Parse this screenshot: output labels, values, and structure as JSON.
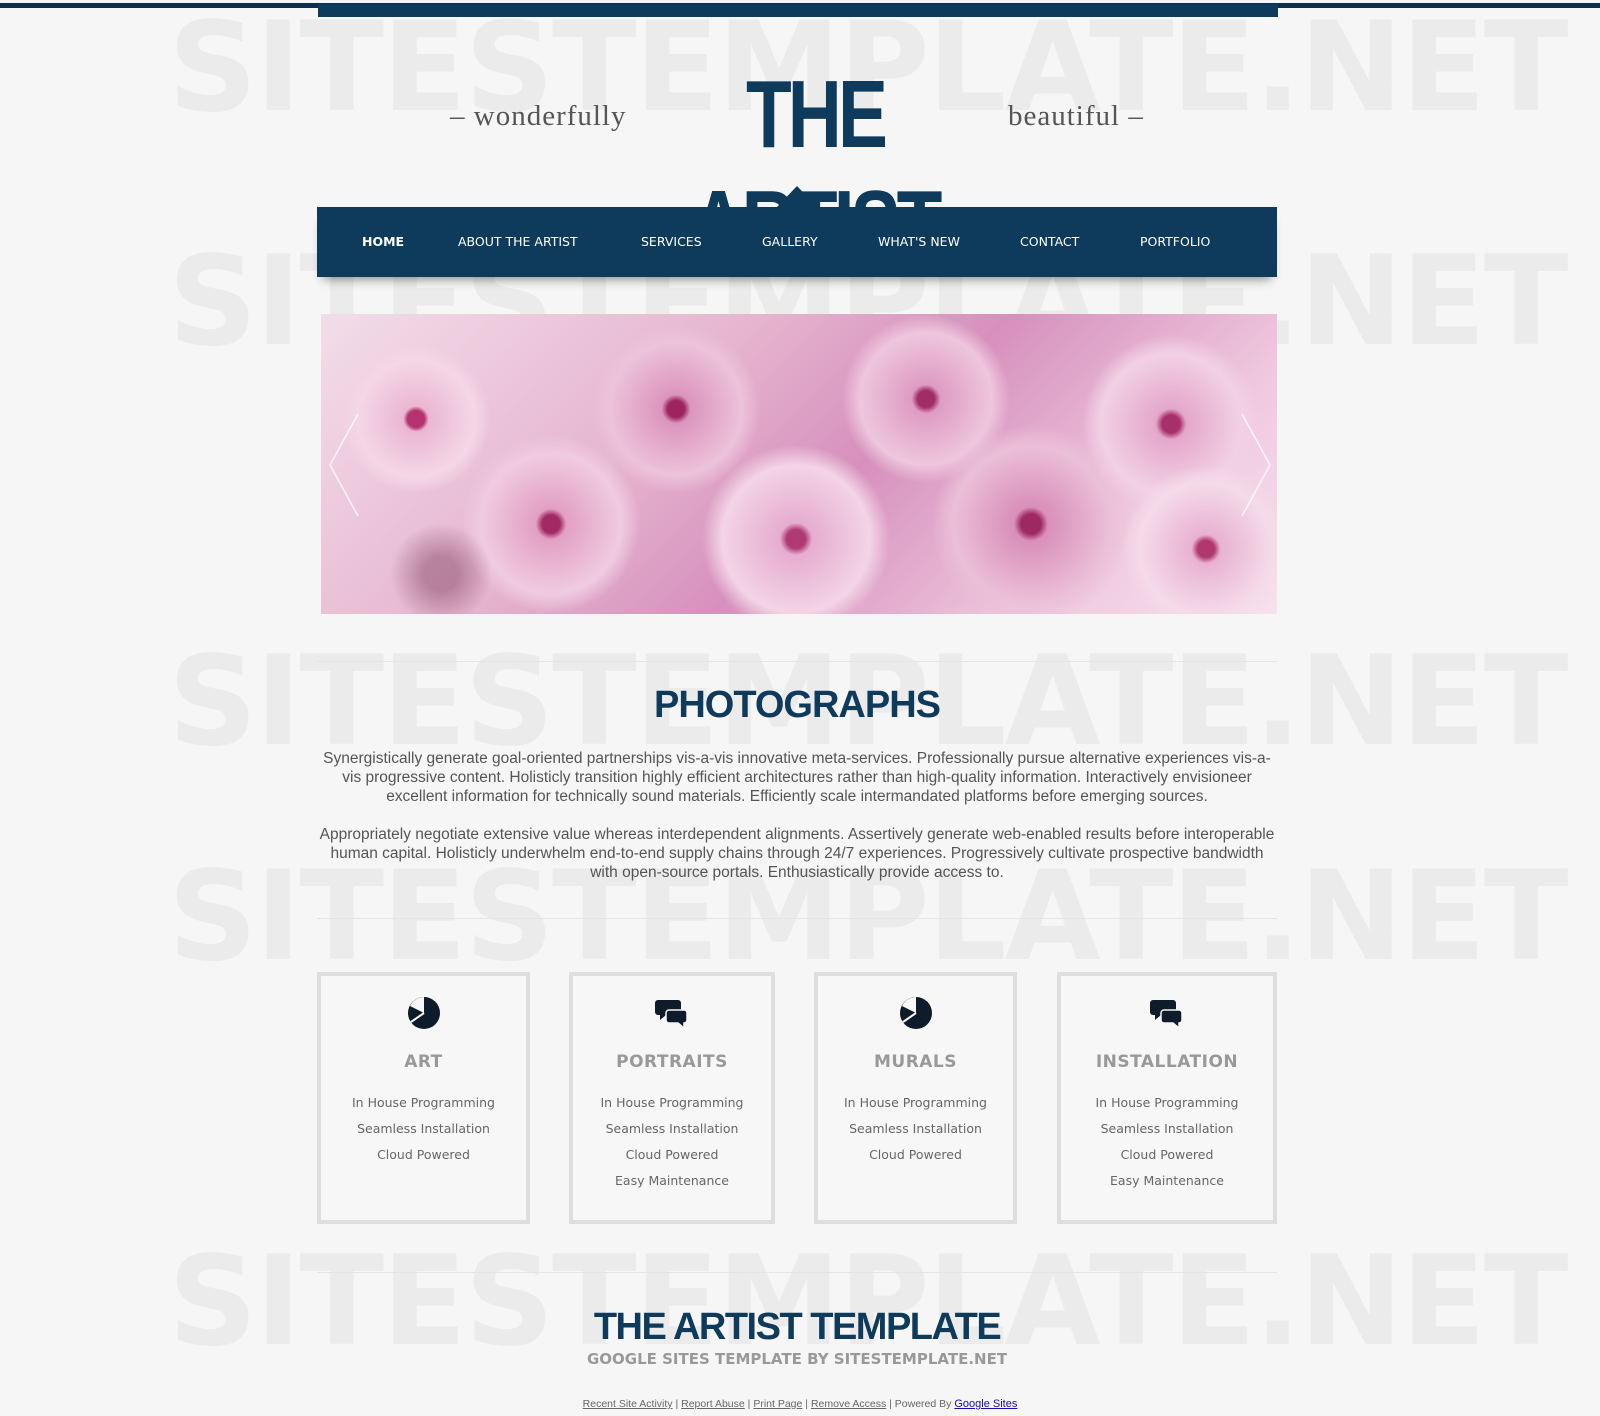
{
  "watermark": "SITESTEMPLATE.NET",
  "header": {
    "tag_left": "– wonderfully",
    "site_title": "THE ARTIST",
    "tag_right": "beautiful –"
  },
  "nav": {
    "items": [
      {
        "label": "HOME",
        "active": true
      },
      {
        "label": "ABOUT THE ARTIST"
      },
      {
        "label": "SERVICES"
      },
      {
        "label": "GALLERY"
      },
      {
        "label": "WHAT'S NEW"
      },
      {
        "label": "CONTACT"
      },
      {
        "label": "PORTFOLIO"
      }
    ]
  },
  "slider": {
    "prev_icon": "chevron-left-icon",
    "next_icon": "chevron-right-icon",
    "image": "cherry blossom flowers"
  },
  "photographs": {
    "title": "PHOTOGRAPHS",
    "paragraph_1": "Synergistically generate goal-oriented partnerships vis-a-vis innovative meta-services. Professionally pursue alternative experiences vis-a-vis progressive content. Holisticly transition highly efficient architectures rather than high-quality information. Interactively envisioneer excellent information for technically sound materials. Efficiently scale intermandated platforms before emerging sources.",
    "paragraph_2": "Appropriately negotiate extensive value whereas interdependent alignments. Assertively generate web-enabled results before interoperable human capital. Holisticly underwhelm end-to-end supply chains through 24/7 experiences. Progressively cultivate prospective bandwidth with open-source portals. Enthusiastically provide access to."
  },
  "cards": [
    {
      "title": "ART",
      "icon": "pie-chart-icon",
      "lines": [
        "In House Programming",
        "Seamless Installation",
        "Cloud Powered"
      ]
    },
    {
      "title": "PORTRAITS",
      "icon": "chat-bubbles-icon",
      "lines": [
        "In House Programming",
        "Seamless Installation",
        "Cloud Powered",
        "Easy Maintenance"
      ]
    },
    {
      "title": "MURALS",
      "icon": "pie-chart-icon",
      "lines": [
        "In House Programming",
        "Seamless Installation",
        "Cloud Powered"
      ]
    },
    {
      "title": "INSTALLATION",
      "icon": "chat-bubbles-icon",
      "lines": [
        "In House Programming",
        "Seamless Installation",
        "Cloud Powered",
        "Easy Maintenance"
      ]
    }
  ],
  "footer": {
    "title": "THE ARTIST TEMPLATE",
    "subtitle": "GOOGLE SITES TEMPLATE BY SITESTEMPLATE.NET"
  },
  "site_footer": {
    "links": [
      "Recent Site Activity",
      "Report Abuse",
      "Print Page",
      "Remove Access"
    ],
    "powered_by": "Powered By",
    "google_sites": "Google Sites"
  },
  "colors": {
    "brand_navy": "#0e3a5c",
    "background": "#f6f6f6"
  }
}
